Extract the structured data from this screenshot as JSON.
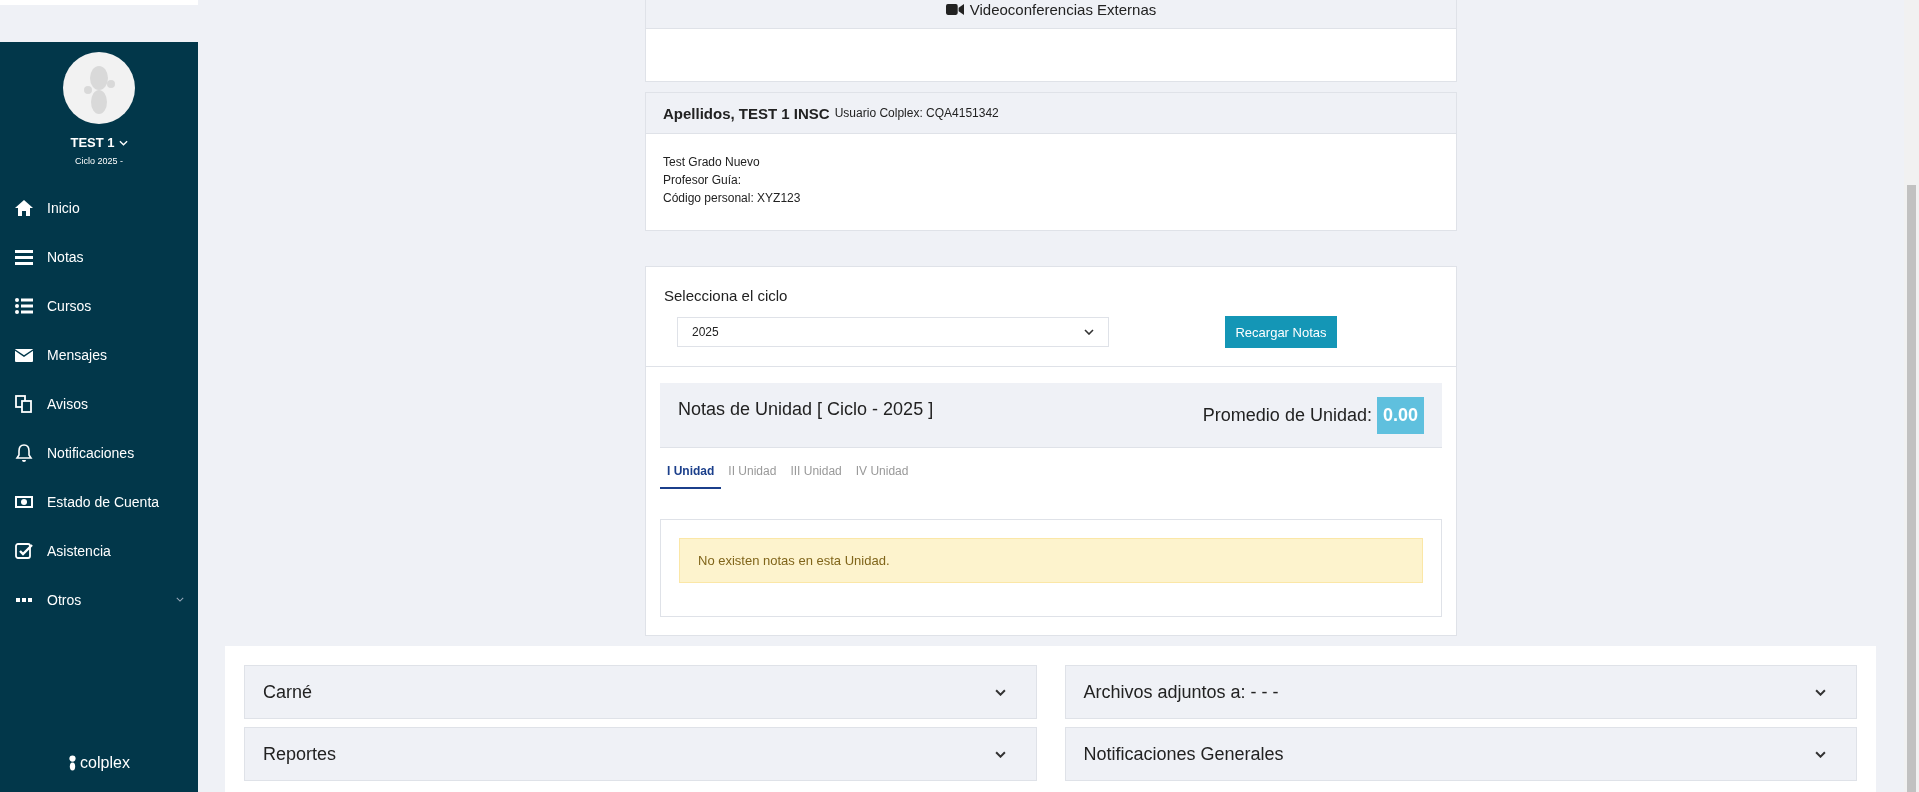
{
  "sidebar": {
    "user_name": "TEST 1",
    "cycle": "Ciclo 2025 -",
    "items": [
      {
        "label": "Inicio",
        "kind": "home",
        "has_submenu": false
      },
      {
        "label": "Notas",
        "kind": "bars",
        "has_submenu": false
      },
      {
        "label": "Cursos",
        "kind": "list",
        "has_submenu": false
      },
      {
        "label": "Mensajes",
        "kind": "envelope",
        "has_submenu": false
      },
      {
        "label": "Avisos",
        "kind": "copy",
        "has_submenu": false
      },
      {
        "label": "Notificaciones",
        "kind": "bell",
        "has_submenu": false
      },
      {
        "label": "Estado de Cuenta",
        "kind": "money",
        "has_submenu": false
      },
      {
        "label": "Asistencia",
        "kind": "check",
        "has_submenu": false
      },
      {
        "label": "Otros",
        "kind": "dots",
        "has_submenu": true
      }
    ],
    "logo": "colplex"
  },
  "video_panel": {
    "title": "Videoconferencias Externas"
  },
  "student_card": {
    "name": "Apellidos, TEST 1 INSC",
    "user_label": "Usuario Colplex: CQA4151342",
    "lines": [
      "Test Grado Nuevo",
      "Profesor Guía:",
      "Código personal: XYZ123"
    ]
  },
  "cycle_select": {
    "label": "Selecciona el ciclo",
    "value": "2025",
    "button": "Recargar Notas"
  },
  "grades": {
    "title": "Notas de Unidad [ Ciclo - 2025 ]",
    "average_label": "Promedio de Unidad:",
    "average": "0.00",
    "tabs": [
      {
        "label": "I Unidad",
        "selected": true
      },
      {
        "label": "II Unidad",
        "selected": false
      },
      {
        "label": "III Unidad",
        "selected": false
      },
      {
        "label": "IV Unidad",
        "selected": false
      }
    ],
    "alert": "No existen notas en esta Unidad."
  },
  "accordions": [
    {
      "title": "Carné"
    },
    {
      "title": "Archivos adjuntos a: - - -"
    },
    {
      "title": "Reportes"
    },
    {
      "title": "Notificaciones Generales"
    }
  ]
}
